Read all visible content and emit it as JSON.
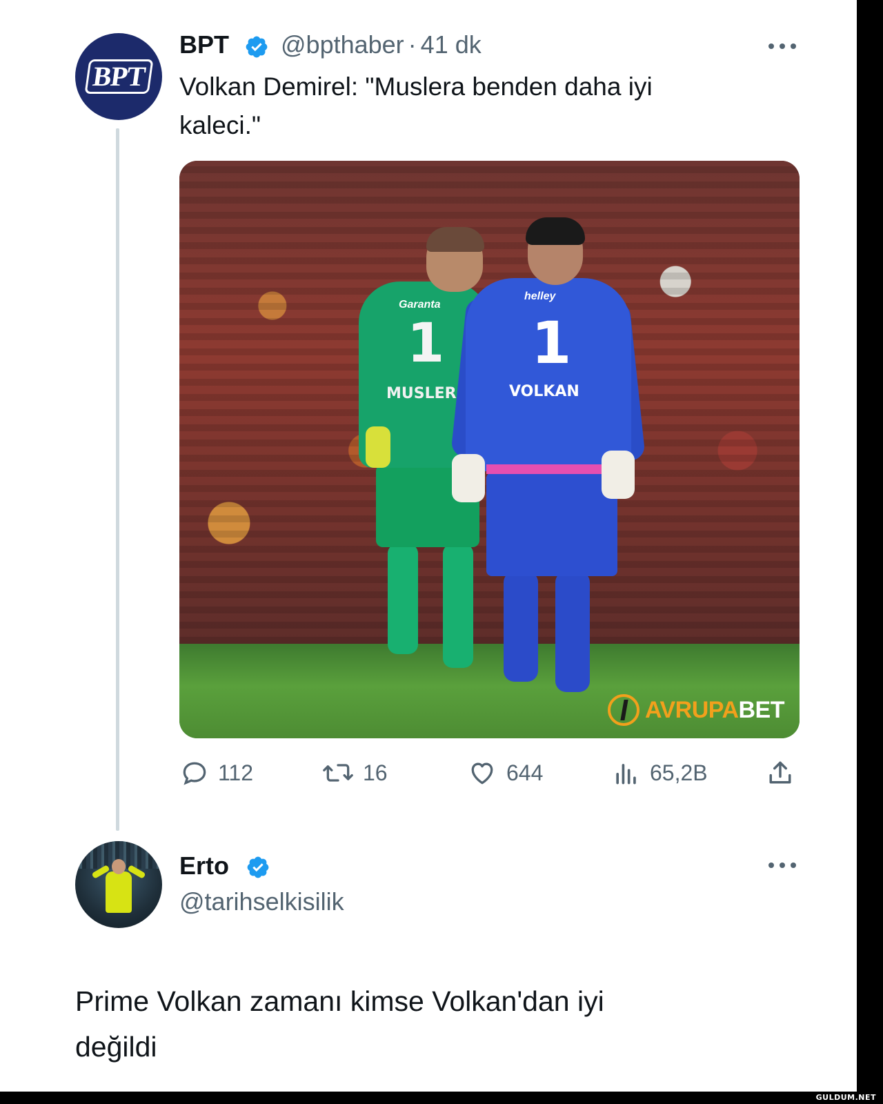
{
  "tweet1": {
    "name": "BPT",
    "handle": "@bpthaber",
    "separator": "·",
    "time": "41 dk",
    "avatar_text": "BPT",
    "text_line1": "Volkan Demirel: \"Muslera benden daha iyi",
    "text_line2": "kaleci.\"",
    "photo": {
      "jersey_left_number": "1",
      "jersey_left_name": "MUSLERA",
      "jersey_left_sponsor": "Garanta",
      "jersey_right_number": "1",
      "jersey_right_name": "VOLKAN",
      "jersey_right_sponsor": "helley",
      "brand_part1": "AVRUPA",
      "brand_part2": "BET"
    },
    "stats": {
      "replies": "112",
      "retweets": "16",
      "likes": "644",
      "views": "65,2B"
    },
    "icons": [
      "verified-badge-icon",
      "more-icon",
      "reply-icon",
      "retweet-icon",
      "like-icon",
      "views-icon",
      "share-icon"
    ]
  },
  "tweet2": {
    "name": "Erto",
    "handle": "@tarihselkisilik",
    "text_line1": "Prime Volkan zamanı kimse Volkan'dan iyi",
    "text_line2": "değildi"
  },
  "watermark": "GULDUM.NET",
  "colors": {
    "verified": "#1d9bf0",
    "secondary_text": "#536471",
    "thread_line": "#cfd9de",
    "bpt_avatar": "#1c2a6b",
    "brand_orange": "#f2a01c"
  }
}
